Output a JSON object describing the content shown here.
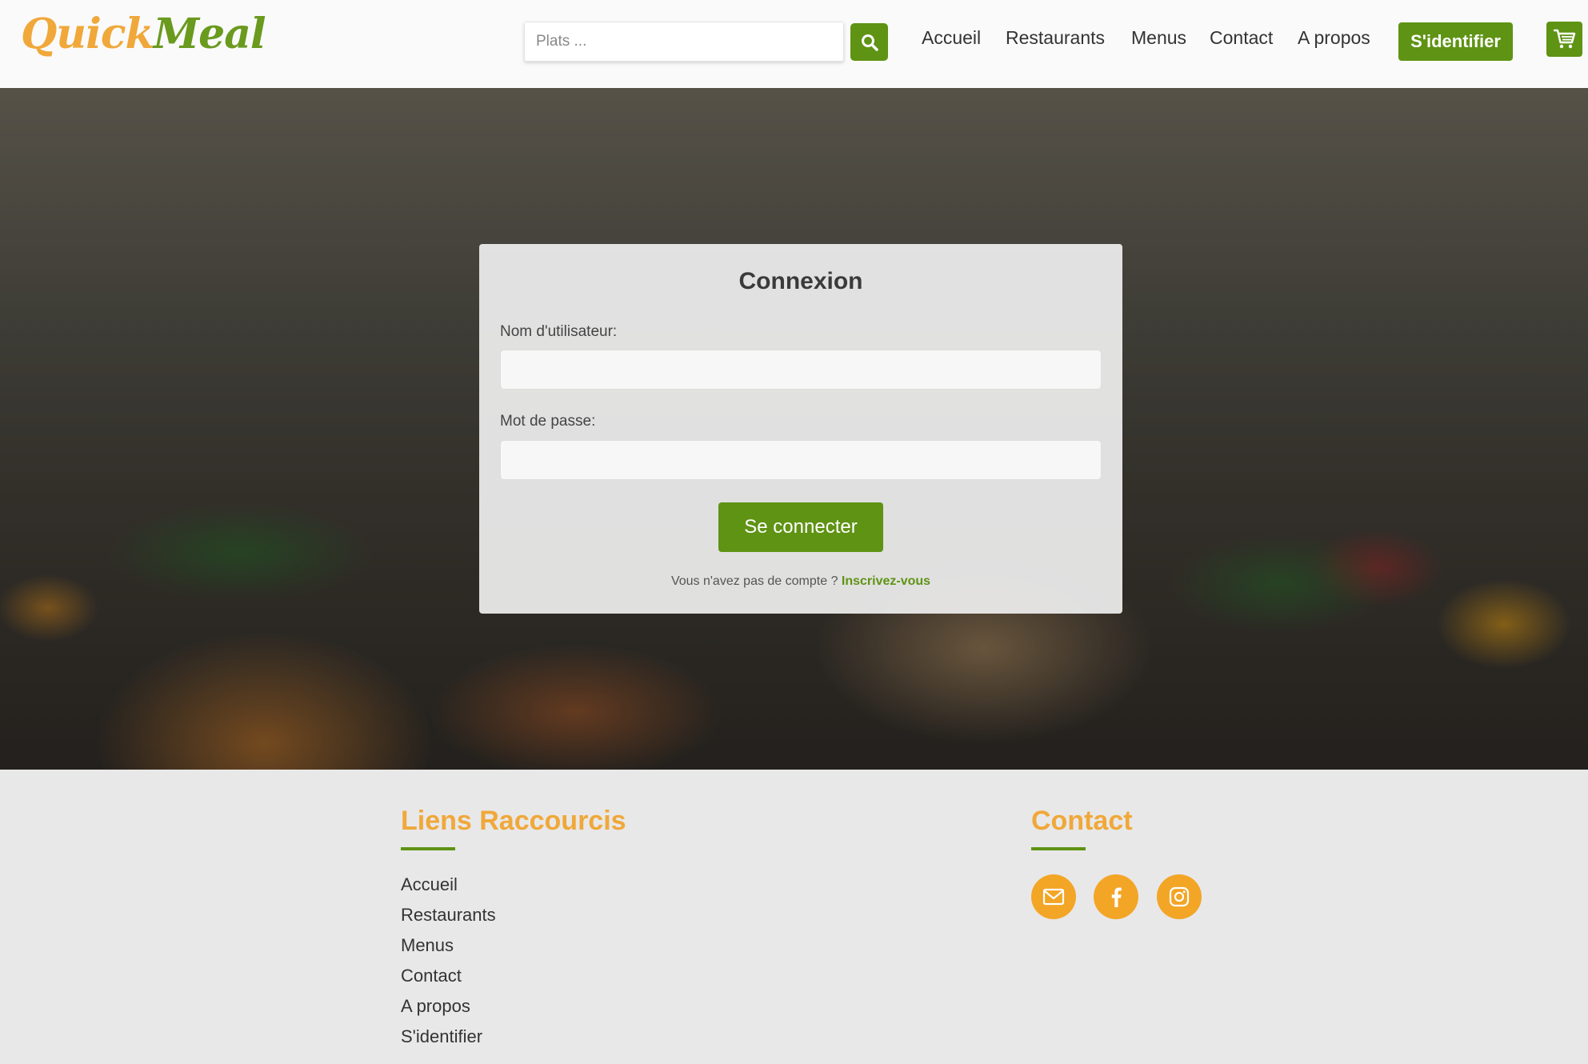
{
  "brand": {
    "logo_part1": "Quick",
    "logo_part2": "Meal"
  },
  "search": {
    "placeholder": "Plats ..."
  },
  "nav": {
    "items": [
      "Accueil",
      "Restaurants",
      "Menus",
      "Contact",
      "A propos"
    ],
    "login_label": "S'identifier"
  },
  "login": {
    "title": "Connexion",
    "username_label": "Nom d'utilisateur:",
    "password_label": "Mot de passe:",
    "submit_label": "Se connecter",
    "no_account_text": "Vous n'avez pas de compte ? ",
    "signup_label": "Inscrivez-vous"
  },
  "footer": {
    "links_heading": "Liens Raccourcis",
    "links": [
      "Accueil",
      "Restaurants",
      "Menus",
      "Contact",
      "A propos",
      "S'identifier"
    ],
    "contact_heading": "Contact"
  },
  "colors": {
    "brand_green": "#5f9314",
    "brand_orange": "#f0a83a",
    "social_orange": "#f3a526"
  },
  "icons": {
    "search": "search-icon",
    "cart": "cart-icon",
    "email": "email-icon",
    "facebook": "facebook-icon",
    "instagram": "instagram-icon"
  }
}
